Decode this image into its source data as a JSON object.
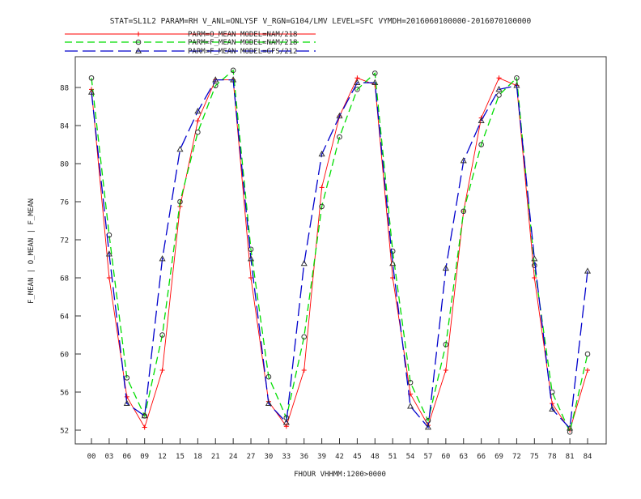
{
  "chart_data": {
    "type": "line",
    "title": "STAT=SL1L2 PARAM=RH V_ANL=ONLYSF V_RGN=G104/LMV LEVEL=SFC VYMDH=2016060100000-2016070100000",
    "xlabel": "FHOUR VHHMM:1200>0000",
    "ylabel": "F_MEAN | O_MEAN | F_MEAN",
    "categories": [
      "00",
      "03",
      "06",
      "09",
      "12",
      "15",
      "18",
      "21",
      "24",
      "27",
      "30",
      "33",
      "36",
      "39",
      "42",
      "45",
      "48",
      "51",
      "54",
      "57",
      "60",
      "63",
      "66",
      "69",
      "72",
      "75",
      "78",
      "81",
      "84"
    ],
    "ylim": [
      51,
      91
    ],
    "yticks": [
      52,
      56,
      60,
      64,
      68,
      72,
      76,
      80,
      84,
      88
    ],
    "grid": false,
    "legend_position": "top-left",
    "series": [
      {
        "name": "PARM=O_MEAN MODEL=NAM/218",
        "color": "#ff0000",
        "dash": "solid",
        "marker": "plus",
        "values": [
          87.8,
          68.0,
          55.5,
          52.3,
          58.3,
          75.5,
          84.5,
          88.8,
          88.8,
          68.0,
          55.0,
          52.4,
          58.3,
          77.5,
          85.0,
          89.0,
          88.3,
          68.0,
          55.8,
          52.5,
          58.3,
          75.0,
          84.8,
          89.0,
          88.2,
          68.0,
          54.8,
          52.0,
          58.3
        ]
      },
      {
        "name": "PARM=F_MEAN MODEL=NAM/218",
        "color": "#00dd00",
        "dash": "dashed",
        "marker": "circle",
        "values": [
          89.0,
          72.5,
          57.5,
          53.5,
          62.0,
          76.0,
          83.3,
          88.2,
          89.8,
          71.0,
          57.6,
          53.3,
          61.8,
          75.5,
          82.8,
          87.8,
          89.5,
          70.8,
          57.0,
          53.0,
          61.0,
          75.0,
          82.0,
          87.2,
          89.0,
          69.3,
          56.0,
          51.8,
          60.0
        ]
      },
      {
        "name": "PARM=F_MEAN MODEL=GFS/212",
        "color": "#0000cc",
        "dash": "longdash",
        "marker": "triangle",
        "values": [
          87.5,
          70.5,
          54.8,
          53.5,
          70.0,
          81.5,
          85.5,
          88.8,
          88.8,
          70.0,
          54.8,
          52.8,
          69.5,
          81.0,
          85.0,
          88.5,
          88.5,
          69.5,
          54.5,
          52.3,
          69.0,
          80.3,
          84.5,
          87.8,
          88.2,
          70.0,
          54.2,
          52.2,
          68.7
        ]
      }
    ]
  }
}
